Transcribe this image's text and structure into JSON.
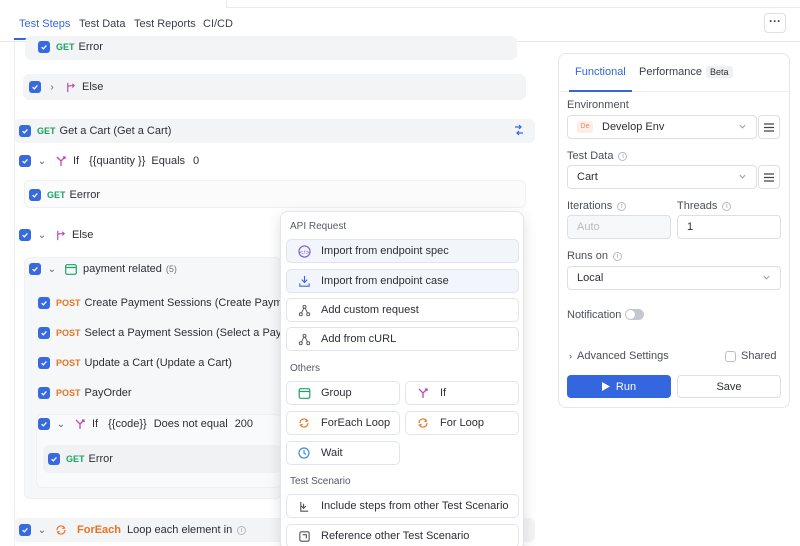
{
  "tabs": [
    "Test Steps",
    "Test Data",
    "Test Reports",
    "CI/CD"
  ],
  "more_label": "···",
  "steps": {
    "top_get_method": "GET",
    "top_get_name": "Error",
    "else1": "Else",
    "get_cart_method": "GET",
    "get_cart_name": "Get a Cart (Get a Cart)",
    "if1_kw": "If",
    "if1_var": "{{quantity }}",
    "if1_op": "Equals",
    "if1_val": "0",
    "eerror_method": "GET",
    "eerror_name": "Eerror",
    "else2": "Else",
    "group_name": "payment related",
    "group_count": "(5)",
    "post1_method": "POST",
    "post1_name": "Create Payment Sessions (Create Payment Se",
    "post2_method": "POST",
    "post2_name": "Select a Payment Session (Select a Payment",
    "post3_method": "POST",
    "post3_name": "Update a Cart (Update a Cart)",
    "post4_method": "POST",
    "post4_name": "PayOrder",
    "if2_kw": "If",
    "if2_var": "{{code}}",
    "if2_op": "Does not equal",
    "if2_val": "200",
    "error2_method": "GET",
    "error2_name": "Error",
    "foreach_kw": "ForEach",
    "foreach_text": "Loop each element in"
  },
  "menu": {
    "api_header": "API Request",
    "import_spec": "Import from endpoint spec",
    "import_case": "Import from endpoint case",
    "add_custom": "Add custom request",
    "add_curl": "Add from cURL",
    "others_header": "Others",
    "group": "Group",
    "if": "If",
    "foreach": "ForEach Loop",
    "forloop": "For Loop",
    "wait": "Wait",
    "scenario_header": "Test Scenario",
    "include": "Include steps from other Test Scenario",
    "reference": "Reference other Test Scenario"
  },
  "panel": {
    "tab_functional": "Functional",
    "tab_performance": "Performance",
    "beta": "Beta",
    "env_label": "Environment",
    "env_badge": "De",
    "env_value": "Develop Env",
    "testdata_label": "Test Data",
    "testdata_value": "Cart",
    "iterations_label": "Iterations",
    "iterations_placeholder": "Auto",
    "threads_label": "Threads",
    "threads_value": "1",
    "runson_label": "Runs on",
    "runson_value": "Local",
    "notification_label": "Notification",
    "advanced_label": "Advanced Settings",
    "shared_label": "Shared",
    "run_label": "Run",
    "save_label": "Save"
  },
  "colors": {
    "accent": "#3466e0",
    "get": "#1aa463",
    "post": "#e67422",
    "if_keyword": "#c04bb3"
  }
}
